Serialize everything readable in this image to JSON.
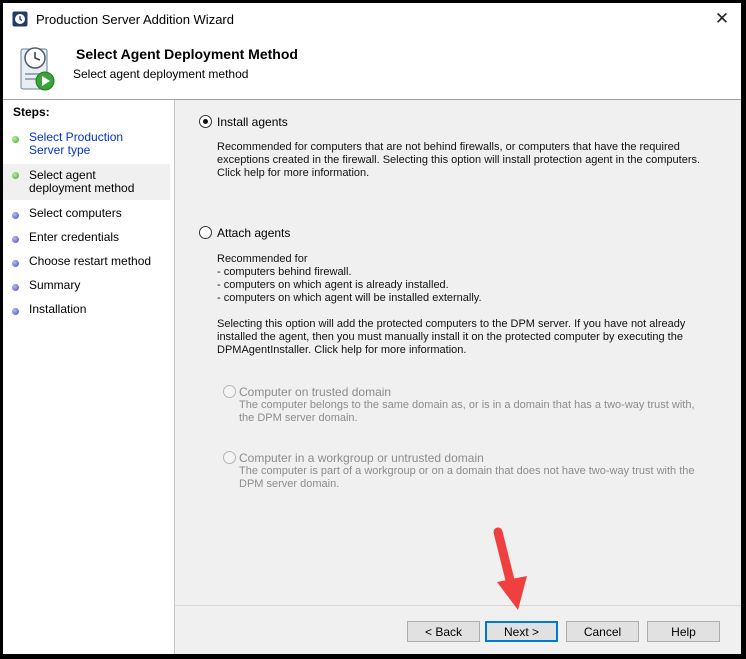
{
  "window": {
    "title": "Production Server Addition Wizard",
    "close_glyph": "✕"
  },
  "header": {
    "title": "Select Agent Deployment Method",
    "subtitle": "Select agent deployment method"
  },
  "sidebar": {
    "title": "Steps:",
    "steps": [
      {
        "label": "Select Production Server type",
        "status": "done"
      },
      {
        "label": "Select agent deployment method",
        "status": "current"
      },
      {
        "label": "Select computers",
        "status": "pending"
      },
      {
        "label": "Enter credentials",
        "status": "pending"
      },
      {
        "label": "Choose restart method",
        "status": "pending"
      },
      {
        "label": "Summary",
        "status": "pending"
      },
      {
        "label": "Installation",
        "status": "pending"
      }
    ]
  },
  "options": {
    "install": {
      "label": "Install agents",
      "selected": true,
      "description": "Recommended for computers that are not behind firewalls, or computers that have the required exceptions created in the firewall. Selecting this option will install protection agent in the computers. Click help for more information."
    },
    "attach": {
      "label": "Attach agents",
      "selected": false,
      "description_lines": [
        "Recommended for",
        "- computers behind firewall.",
        "- computers on which agent is already installed.",
        "- computers on which agent will be installed externally."
      ],
      "note": "Selecting this option will add the protected computers to the DPM server. If you have not already installed the agent, then you must manually install it on the protected computer by executing the DPMAgentInstaller. Click help for more information.",
      "sub_options": {
        "trusted": {
          "label": "Computer on trusted domain",
          "description": "The computer belongs to the same domain as, or is in a domain that has a two-way trust with, the DPM server domain.",
          "enabled": false
        },
        "workgroup": {
          "label": "Computer in a workgroup or untrusted domain",
          "description": "The computer is part of a workgroup or on a domain that does not have two-way trust with the DPM server domain.",
          "enabled": false
        }
      }
    }
  },
  "buttons": {
    "back": "< Back",
    "next": "Next >",
    "cancel": "Cancel",
    "help": "Help"
  },
  "colors": {
    "annotation_arrow": "#ef3f3f",
    "default_button_border": "#0078d7",
    "link_step": "#0033cc"
  }
}
